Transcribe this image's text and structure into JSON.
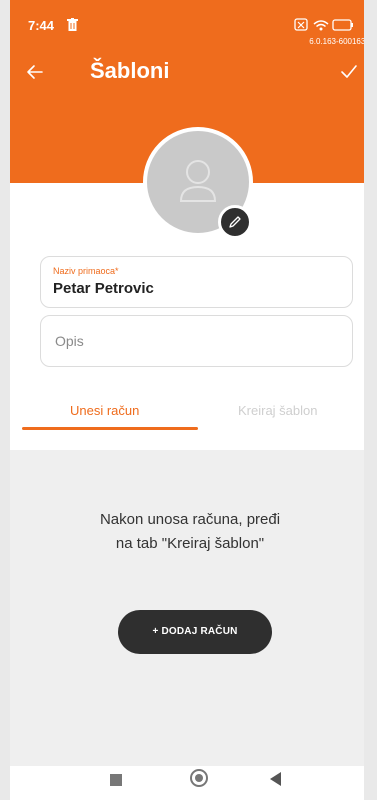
{
  "status_bar": {
    "time": "7:44",
    "battery": "82",
    "version": "6.0.163-600163-"
  },
  "header": {
    "title": "Šabloni"
  },
  "form": {
    "recipient_label": "Naziv primaoca*",
    "recipient_value": "Petar Petrovic",
    "description_placeholder": "Opis"
  },
  "tabs": [
    {
      "label": "Unesi račun",
      "active": true
    },
    {
      "label": "Kreiraj šablon",
      "active": false
    }
  ],
  "content": {
    "info_text": "Nakon unosa računa, pređi na tab \"Kreiraj šablon\"",
    "add_button_label": "+ DODAJ RAČUN"
  },
  "colors": {
    "accent": "#ef6c1d",
    "dark": "#2f2f2f"
  }
}
